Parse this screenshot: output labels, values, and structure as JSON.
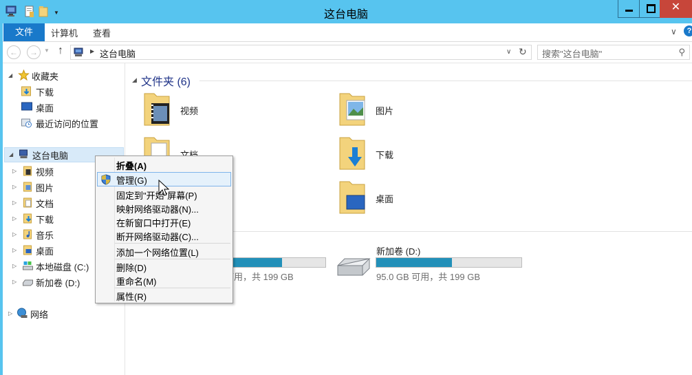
{
  "window": {
    "title": "这台电脑",
    "buttons": {
      "minimize": "minimize",
      "maximize": "maximize",
      "close": "✕"
    }
  },
  "ribbon": {
    "tabs": [
      "文件",
      "计算机",
      "查看"
    ]
  },
  "address": {
    "crumb": "这台电脑",
    "search_placeholder": "搜索\"这台电脑\""
  },
  "nav": {
    "favorites": {
      "label": "收藏夹",
      "items": [
        "下载",
        "桌面",
        "最近访问的位置"
      ]
    },
    "this_pc": {
      "label": "这台电脑",
      "items": [
        "视频",
        "图片",
        "文档",
        "下载",
        "音乐",
        "桌面",
        "本地磁盘 (C:)",
        "新加卷 (D:)"
      ]
    },
    "network": {
      "label": "网络"
    }
  },
  "content": {
    "folders_header": "文件夹 (6)",
    "folders": [
      "视频",
      "图片",
      "文档",
      "下载",
      "桌面"
    ],
    "drives": [
      {
        "name": ")",
        "free": "可用，共 199 GB",
        "used_fraction": 0.63
      },
      {
        "name": "新加卷 (D:)",
        "free": "95.0 GB 可用，共 199 GB",
        "used_fraction": 0.52
      }
    ]
  },
  "context_menu": {
    "items": [
      {
        "label": "折叠(A)",
        "bold": true
      },
      {
        "label": "管理(G)",
        "hover": true,
        "icon": "shield-icon"
      },
      {
        "label": "固定到\"开始\"屏幕(P)"
      },
      {
        "label": "映射网络驱动器(N)..."
      },
      {
        "label": "在新窗口中打开(E)"
      },
      {
        "label": "断开网络驱动器(C)..."
      },
      {
        "label": "添加一个网络位置(L)"
      },
      {
        "label": "删除(D)"
      },
      {
        "label": "重命名(M)"
      },
      {
        "label": "属性(R)"
      }
    ]
  },
  "colors": {
    "title_bar": "#57c4ef",
    "file_tab": "#1979ca",
    "close_button": "#c7463a",
    "drive_bar_fill": "#2290b9",
    "group_header": "#1e3287"
  }
}
